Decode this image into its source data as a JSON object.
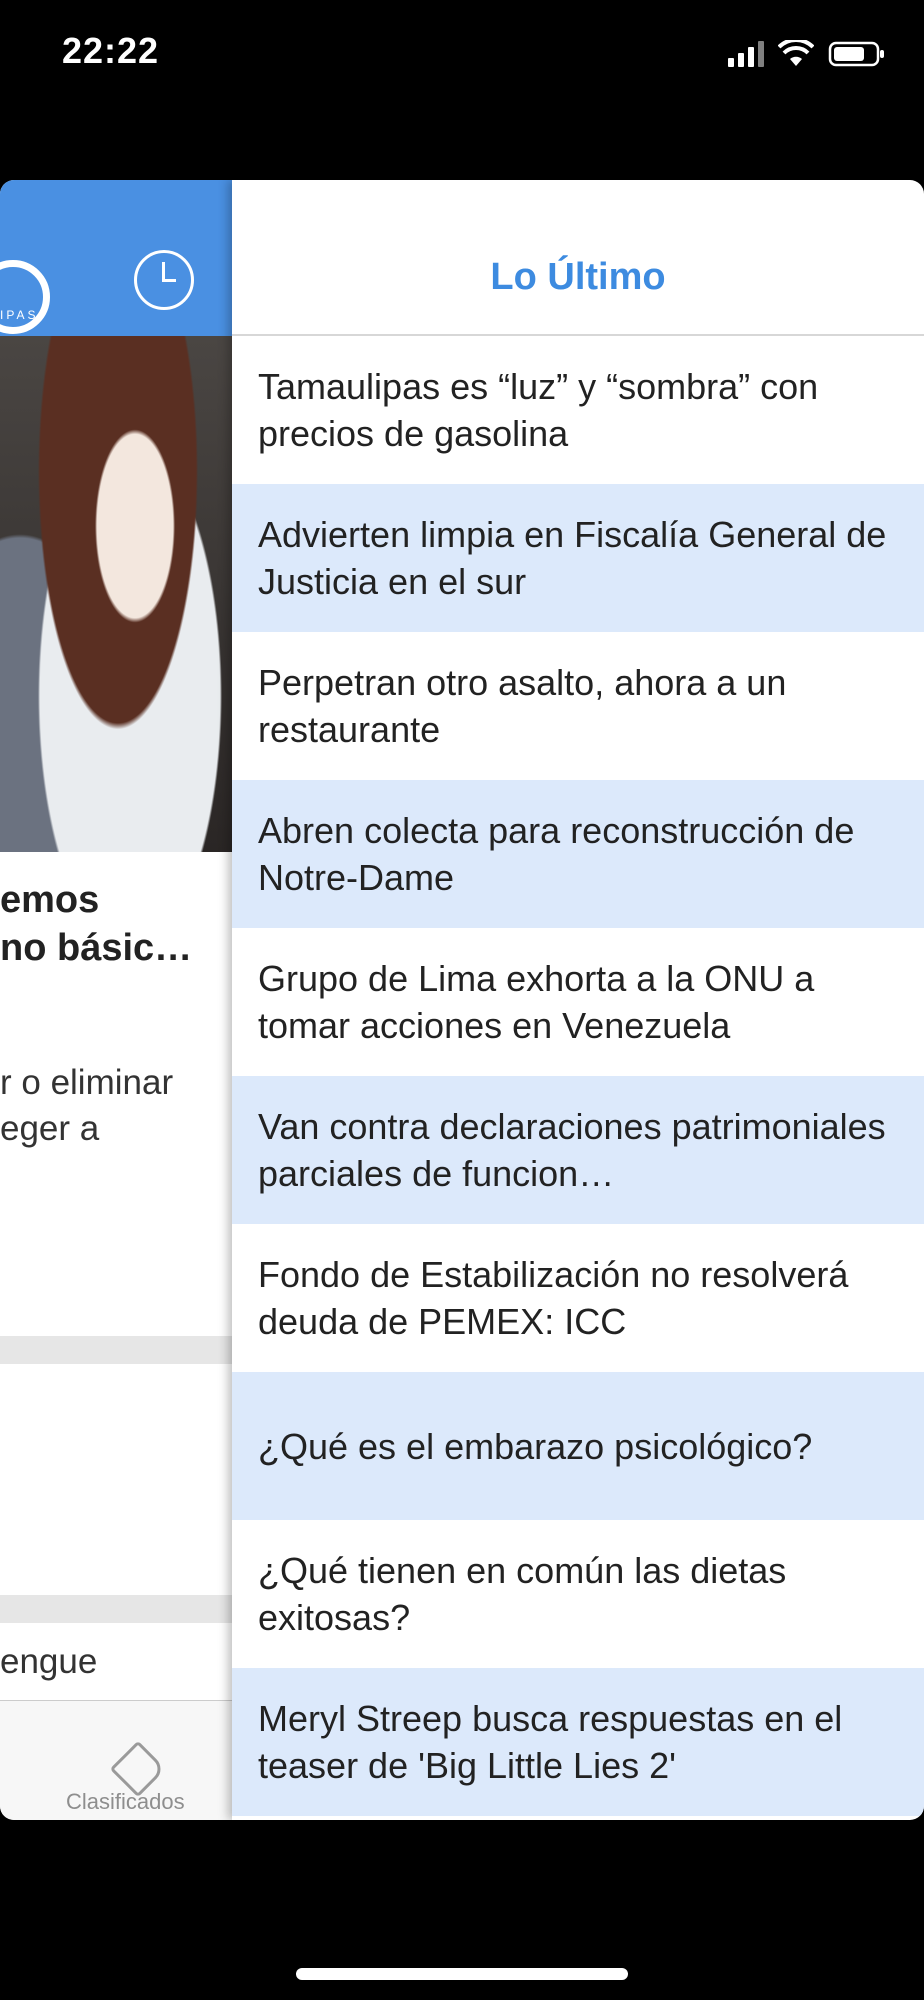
{
  "status_bar": {
    "time": "22:22",
    "icons": [
      "cellular-signal-icon",
      "wifi-icon",
      "battery-icon"
    ]
  },
  "background_app": {
    "header_color": "#4a90e2",
    "headline": [
      "emos",
      "no básic…"
    ],
    "summary": [
      "r o eliminar",
      "eger a"
    ],
    "partial_word": "engue",
    "tab_label": "Clasificados"
  },
  "drawer": {
    "title": "Lo Último",
    "accent_color": "#3d8be0",
    "alt_row_color": "#dce9fb",
    "items": [
      {
        "title": "Tamaulipas es “luz” y “sombra” con precios de gasolina"
      },
      {
        "title": "Advierten limpia en Fiscalía General de Justicia en el sur"
      },
      {
        "title": "Perpetran otro asalto, ahora a un restaurante"
      },
      {
        "title": "Abren colecta para reconstrucción de Notre-Dame"
      },
      {
        "title": "Grupo de Lima exhorta a la ONU a tomar acciones en Venezuela"
      },
      {
        "title": "Van contra declaraciones patrimoniales parciales de funcion…"
      },
      {
        "title": "Fondo de Estabilización no resolverá deuda de PEMEX: ICC"
      },
      {
        "title": "¿Qué es el embarazo psicológico?"
      },
      {
        "title": "¿Qué tienen en común las dietas exitosas?"
      },
      {
        "title": "Meryl Streep busca respuestas en el teaser de 'Big Little Lies 2'"
      }
    ]
  }
}
